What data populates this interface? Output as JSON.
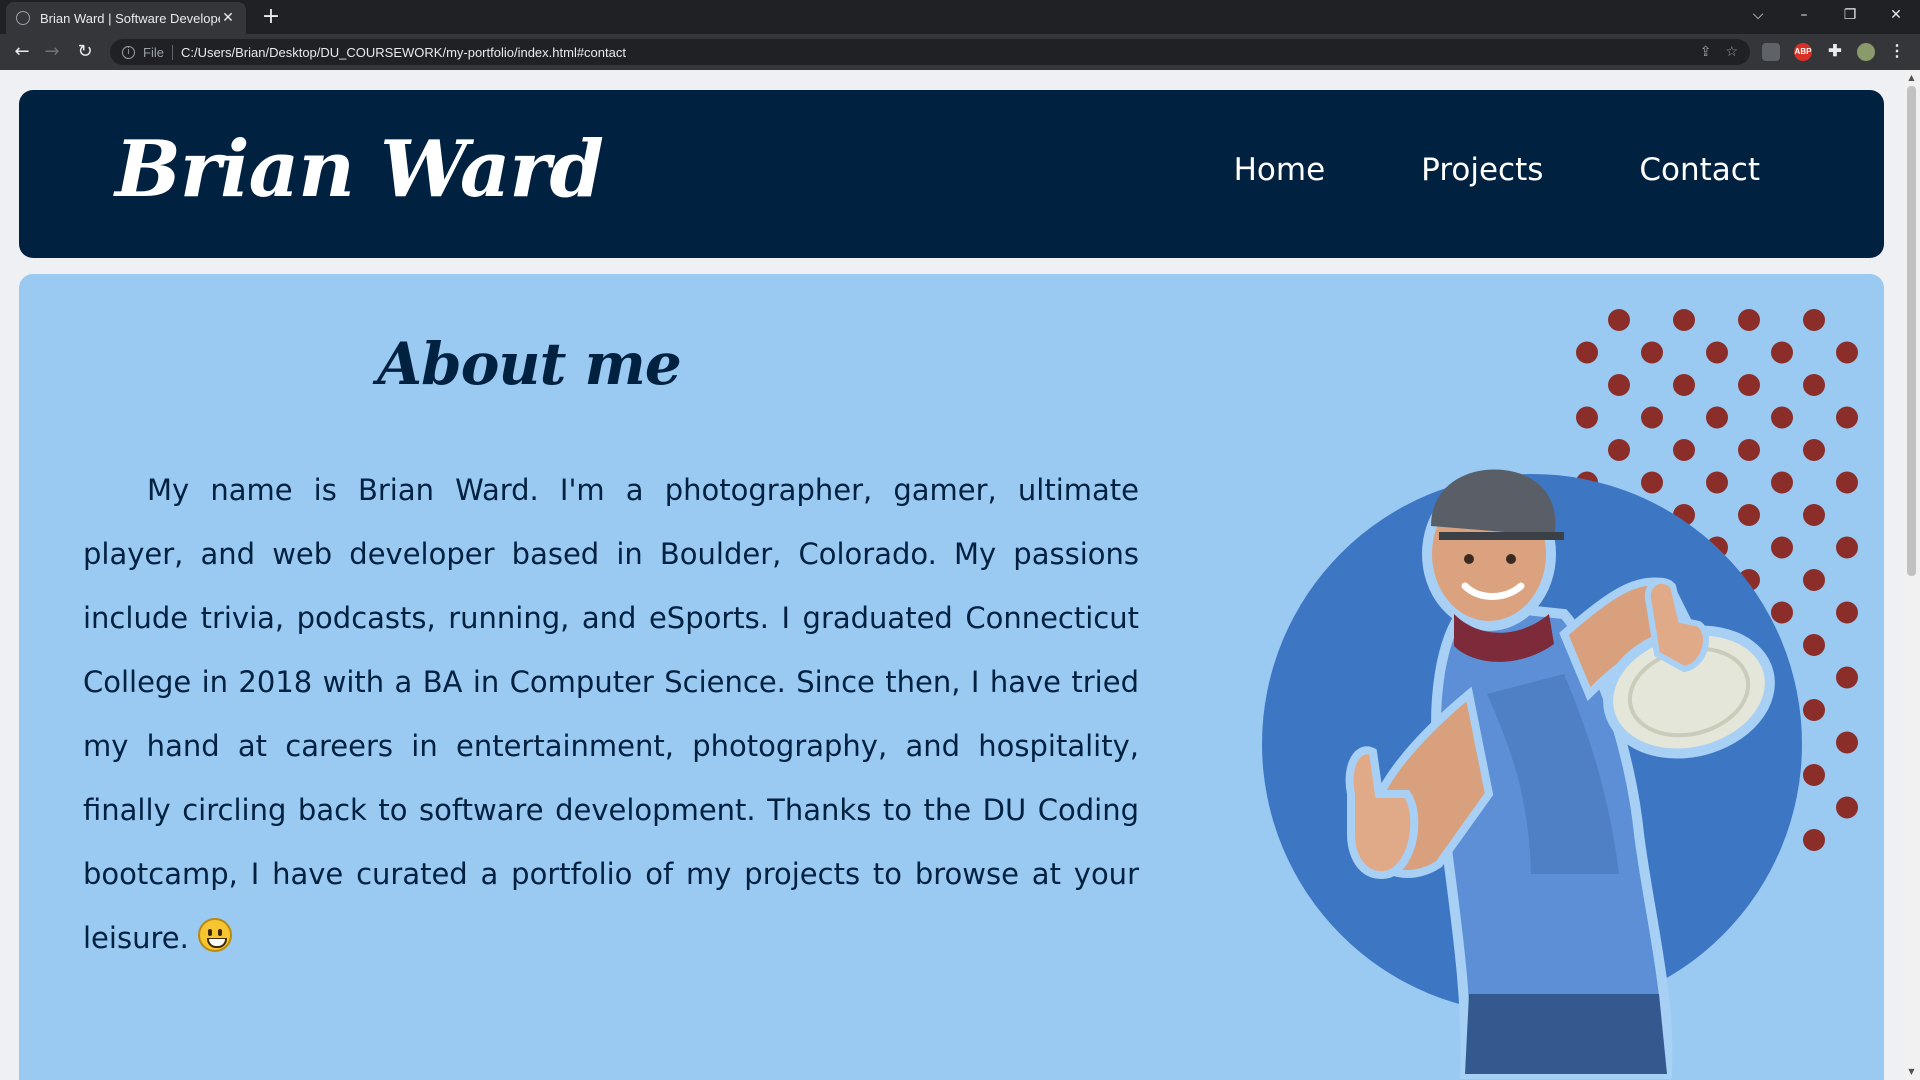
{
  "browser": {
    "tab_title": "Brian Ward | Software Developer",
    "tab_close": "✕",
    "new_tab": "+",
    "scheme": "File",
    "url": "C:/Users/Brian/Desktop/DU_COURSEWORK/my-portfolio/index.html#contact",
    "window_controls": {
      "dropdown": "⌵",
      "minimize": "–",
      "restore": "❐",
      "close": "✕"
    },
    "extensions": [
      "ABP"
    ]
  },
  "header": {
    "logo": "Brian Ward",
    "nav": [
      {
        "label": "Home"
      },
      {
        "label": "Projects"
      },
      {
        "label": "Contact"
      }
    ]
  },
  "about": {
    "title": "About me",
    "paragraph": "My name is Brian Ward. I'm a photographer, gamer, ultimate player, and web developer based in Boulder, Colorado. My passions include trivia, podcasts, running, and eSports. I graduated Connecticut College in 2018 with a BA in Computer Science. Since then, I have tried my hand at careers in entertainment, photography, and hospitality, finally circling back to software development. Thanks to the DU Coding bootcamp, I have curated a portfolio of my projects to browse at your leisure."
  },
  "colors": {
    "header_bg": "#012140",
    "about_bg": "#9ac9f2",
    "dot_color": "#8b2e2a",
    "circle_color": "#3d77c4",
    "text_dark": "#012140"
  }
}
